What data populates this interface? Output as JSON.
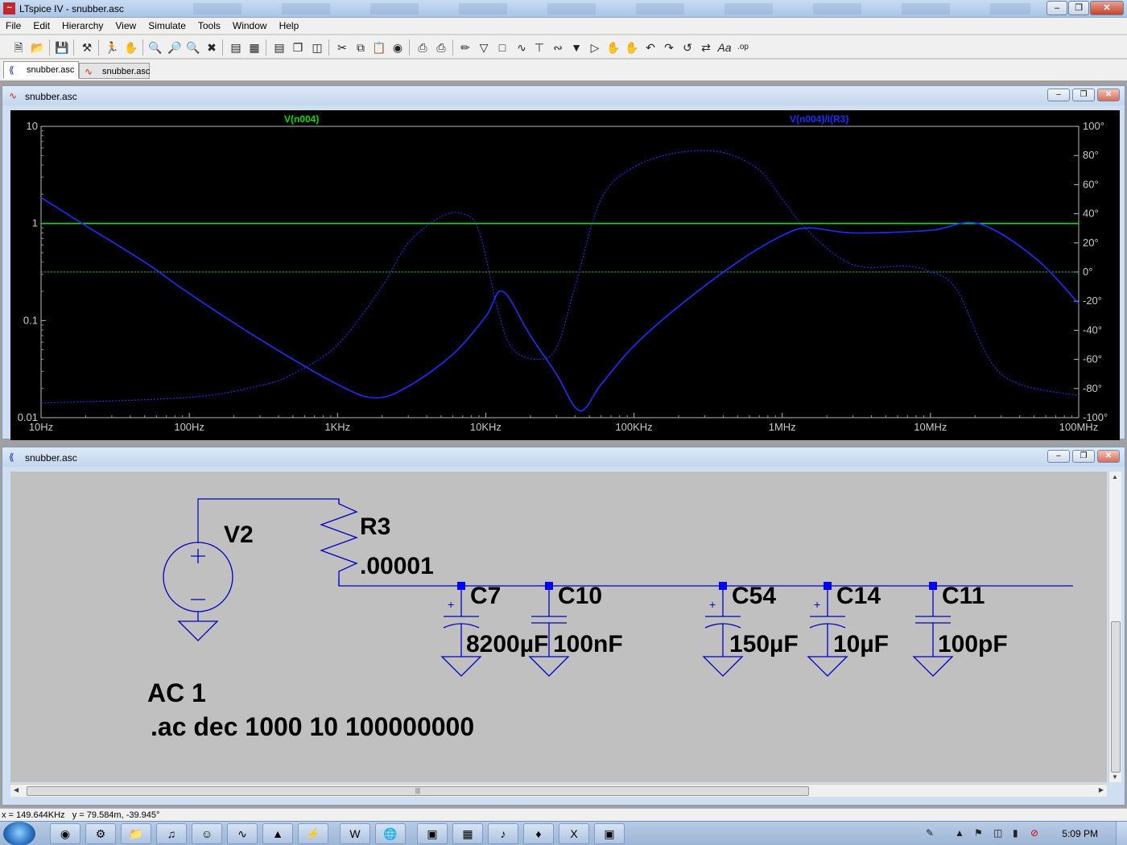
{
  "window": {
    "title": "LTspice IV - snubber.asc"
  },
  "menu": [
    "File",
    "Edit",
    "Hierarchy",
    "View",
    "Simulate",
    "Tools",
    "Window",
    "Help"
  ],
  "toolbar_icons": [
    "new-schematic-icon",
    "open-icon",
    "save-icon",
    "control-panel-icon",
    "run-icon",
    "halt-icon",
    "zoom-in-icon",
    "zoom-area-icon",
    "zoom-out-icon",
    "zoom-cancel-icon",
    "autorange-icon",
    "grid-icon",
    "tile-horizontal-icon",
    "cascade-icon",
    "tile-vertical-icon",
    "cut-icon",
    "copy-icon",
    "paste-icon",
    "find-icon",
    "print-setup-icon",
    "print-icon",
    "wire-icon",
    "ground-icon",
    "label-icon",
    "resistor-icon",
    "capacitor-icon",
    "inductor-icon",
    "diode-icon",
    "component-icon",
    "move-icon",
    "drag-icon",
    "undo-icon",
    "redo-icon",
    "rotate-icon",
    "mirror-icon",
    "text-icon",
    "spice-directive-icon"
  ],
  "tabs": [
    {
      "label": "snubber.asc",
      "kind": "schematic"
    },
    {
      "label": "snubber.asc",
      "kind": "waveform"
    }
  ],
  "waveform_window": {
    "title": "snubber.asc",
    "trace_labels": {
      "left": "V(n004)",
      "right": "V(n004)/I(R3)"
    },
    "colors": {
      "left": "#00dd00",
      "right": "#1a2fff",
      "background": "#000000"
    }
  },
  "schematic_window": {
    "title": "snubber.asc",
    "source": {
      "name": "V2",
      "value": "AC 1"
    },
    "resistor": {
      "name": "R3",
      "value": ".00001"
    },
    "capacitors": [
      {
        "name": "C7",
        "value": "8200µF"
      },
      {
        "name": "C10",
        "value": "100nF"
      },
      {
        "name": "C54",
        "value": "150µF"
      },
      {
        "name": "C14",
        "value": "10µF"
      },
      {
        "name": "C11",
        "value": "100pF"
      }
    ],
    "directive": ".ac dec 1000 10 100000000"
  },
  "chart_data": {
    "type": "line",
    "title": "",
    "x_scale": "log",
    "xlim": [
      10,
      100000000
    ],
    "x_ticks": [
      {
        "value": 10,
        "label": "10Hz"
      },
      {
        "value": 100,
        "label": "100Hz"
      },
      {
        "value": 1000,
        "label": "1KHz"
      },
      {
        "value": 10000,
        "label": "10KHz"
      },
      {
        "value": 100000,
        "label": "100KHz"
      },
      {
        "value": 1000000,
        "label": "1MHz"
      },
      {
        "value": 10000000,
        "label": "10MHz"
      },
      {
        "value": 100000000,
        "label": "100MHz"
      }
    ],
    "y_left": {
      "scale": "log",
      "lim": [
        0.01,
        10
      ],
      "ticks": [
        {
          "value": 10,
          "label": "10"
        },
        {
          "value": 1,
          "label": "1"
        },
        {
          "value": 0.1,
          "label": "0.1"
        },
        {
          "value": 0.01,
          "label": "0.01"
        }
      ]
    },
    "y_right": {
      "scale": "linear",
      "lim": [
        -100,
        100
      ],
      "ticks": [
        {
          "value": 100,
          "label": "100°"
        },
        {
          "value": 80,
          "label": "80°"
        },
        {
          "value": 60,
          "label": "60°"
        },
        {
          "value": 40,
          "label": "40°"
        },
        {
          "value": 20,
          "label": "20°"
        },
        {
          "value": 0,
          "label": "0°"
        },
        {
          "value": -20,
          "label": "-20°"
        },
        {
          "value": -40,
          "label": "-40°"
        },
        {
          "value": -60,
          "label": "-60°"
        },
        {
          "value": -80,
          "label": "-80°"
        },
        {
          "value": -100,
          "label": "-100°"
        }
      ]
    },
    "series": [
      {
        "name": "V(n004)",
        "role": "magnitude",
        "axis": "left",
        "color": "#00dd00",
        "dash": "solid",
        "x": [
          10,
          100000000
        ],
        "y": [
          1,
          1
        ]
      },
      {
        "name": "V(n004)",
        "role": "phase",
        "axis": "right",
        "color": "#00dd00",
        "dash": "dotted",
        "x": [
          10,
          100000000
        ],
        "y": [
          0,
          0
        ]
      },
      {
        "name": "V(n004)/I(R3)",
        "role": "magnitude",
        "axis": "left",
        "color": "#1a2fff",
        "dash": "solid",
        "x": [
          10,
          20,
          50,
          100,
          300,
          1000,
          1800,
          3000,
          6000,
          10000,
          13000,
          20000,
          30000,
          43000,
          60000,
          100000,
          200000,
          500000,
          1000000,
          1500000,
          3000000,
          10000000,
          21000000,
          50000000,
          100000000
        ],
        "y": [
          1.85,
          0.95,
          0.4,
          0.19,
          0.064,
          0.022,
          0.016,
          0.021,
          0.045,
          0.11,
          0.2,
          0.07,
          0.028,
          0.0118,
          0.022,
          0.055,
          0.14,
          0.4,
          0.75,
          0.9,
          0.8,
          0.85,
          1.0,
          0.45,
          0.15
        ]
      },
      {
        "name": "V(n004)/I(R3)",
        "role": "phase",
        "axis": "right",
        "color": "#1a2fff",
        "dash": "dotted",
        "x": [
          10,
          100,
          300,
          500,
          1000,
          2000,
          3000,
          5000,
          7000,
          9000,
          12000,
          15000,
          22000,
          30000,
          40000,
          60000,
          100000,
          200000,
          400000,
          700000,
          1000000,
          1500000,
          3000000,
          7000000,
          10000000,
          15000000,
          30000000,
          100000000
        ],
        "y": [
          -90,
          -86,
          -78,
          -70,
          -50,
          -10,
          20,
          38,
          40,
          28,
          -25,
          -52,
          -60,
          -52,
          -10,
          50,
          72,
          82,
          82,
          70,
          50,
          28,
          5,
          4,
          0,
          -12,
          -70,
          -85
        ]
      }
    ]
  },
  "status": {
    "text": "x = 149.644KHz   y = 79.584m, -39.945°"
  },
  "taskbar": {
    "apps": [
      "chrome-icon",
      "control-panel-icon",
      "explorer-icon",
      "itunes-icon",
      "gimp-icon",
      "ltspice-icon",
      "acrobat-icon",
      "flash-icon",
      "word-icon",
      "browser-icon",
      "screenshot-icon",
      "calculator-icon",
      "sound-icon",
      "python-icon",
      "excel-icon",
      "foxit-icon"
    ],
    "clock": "5:09 PM"
  }
}
